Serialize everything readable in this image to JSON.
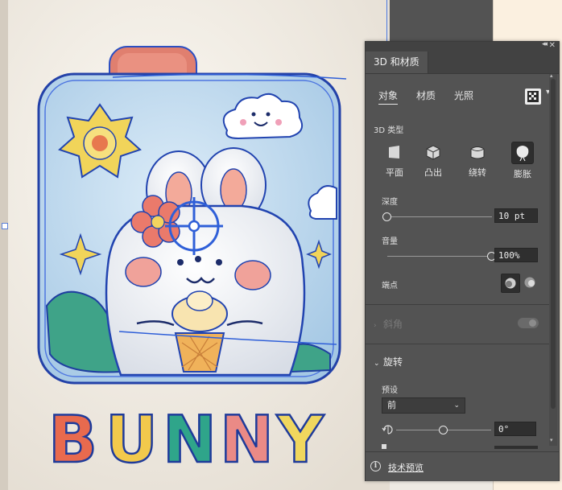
{
  "panel": {
    "tab": "3D 和材质",
    "subtabs": [
      "对象",
      "材质",
      "光照"
    ],
    "type_label": "3D 类型",
    "types": [
      {
        "label": "平面",
        "icon": "plane-icon",
        "active": false
      },
      {
        "label": "凸出",
        "icon": "extrude-icon",
        "active": false
      },
      {
        "label": "绕转",
        "icon": "revolve-icon",
        "active": false
      },
      {
        "label": "膨胀",
        "icon": "inflate-icon",
        "active": true
      }
    ],
    "depth": {
      "label": "深度",
      "value": "10 pt",
      "level": 0.0
    },
    "volume": {
      "label": "音量",
      "value": "100%",
      "level": 1.0
    },
    "caps_label": "端点",
    "bevel": {
      "label": "斜角",
      "enabled": false
    },
    "rotation": {
      "label": "旋转",
      "preset_label": "预设",
      "preset_value": "前",
      "angle_value": "0°",
      "angle_level": 0.5
    },
    "footer_link": "技术预览"
  },
  "artwork": {
    "text": [
      "B",
      "U",
      "N",
      "N",
      "Y"
    ],
    "letter_colors": [
      "#e86a4e",
      "#f2c94c",
      "#2fa58a",
      "#ea8a86",
      "#f0d75e"
    ],
    "frame_fill": "#b9d8ee",
    "accent": "#2f5fd8"
  },
  "colors": {
    "panel_bg": "#535353",
    "panel_header": "#424242",
    "field_bg": "#2f2f2f",
    "selection_blue": "#2f5fd8"
  }
}
